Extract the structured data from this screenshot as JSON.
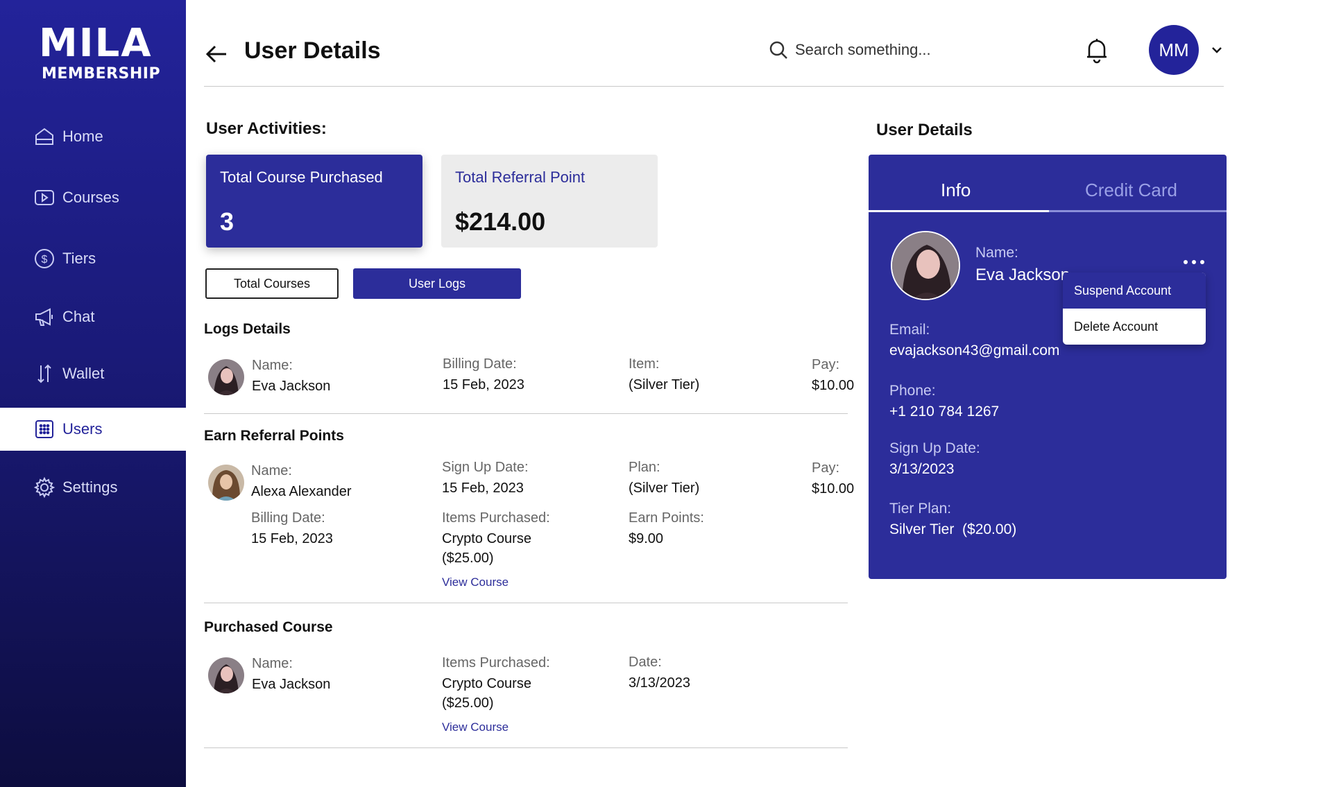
{
  "brand": {
    "logo_top": "MILA",
    "logo_bottom": "MEMBERSHIP"
  },
  "sidebar": {
    "items": [
      {
        "label": "Home",
        "icon": "home-icon"
      },
      {
        "label": "Courses",
        "icon": "play-icon"
      },
      {
        "label": "Tiers",
        "icon": "dollar-icon"
      },
      {
        "label": "Chat",
        "icon": "megaphone-icon"
      },
      {
        "label": "Wallet",
        "icon": "transfer-arrows-icon"
      },
      {
        "label": "Users",
        "icon": "users-grid-icon",
        "active": true
      },
      {
        "label": "Settings",
        "icon": "gear-icon"
      }
    ]
  },
  "header": {
    "title": "User Details",
    "search_placeholder": "Search something...",
    "avatar_initials": "MM"
  },
  "activities": {
    "heading": "User Activities:",
    "total_course_label": "Total Course Purchased",
    "total_course_value": "3",
    "referral_label": "Total Referral Point",
    "referral_value": "$214.00",
    "btn_total_courses": "Total Courses",
    "btn_user_logs": "User Logs"
  },
  "logs": {
    "heading": "Logs Details",
    "name_label": "Name:",
    "name_value": "Eva Jackson",
    "billing_label": "Billing Date:",
    "billing_value": "15 Feb, 2023",
    "item_label": "Item:",
    "item_value": "(Silver Tier)",
    "pay_label": "Pay:",
    "pay_value": "$10.00"
  },
  "referral": {
    "heading": "Earn Referral Points",
    "name_label": "Name:",
    "name_value": "Alexa Alexander",
    "signup_label": "Sign Up Date:",
    "signup_value": "15 Feb, 2023",
    "plan_label": "Plan:",
    "plan_value": "(Silver Tier)",
    "pay_label": "Pay:",
    "pay_value": "$10.00",
    "billing_label": "Billing Date:",
    "billing_value": "15 Feb, 2023",
    "items_label": "Items Purchased:",
    "items_value_1": "Crypto Course",
    "items_value_2": "($25.00)",
    "earn_label": "Earn Points:",
    "earn_value": "$9.00",
    "view_course": "View Course"
  },
  "purchased": {
    "heading": "Purchased Course",
    "name_label": "Name:",
    "name_value": "Eva Jackson",
    "items_label": "Items Purchased:",
    "items_value_1": "Crypto Course",
    "items_value_2": "($25.00)",
    "date_label": "Date:",
    "date_value": "3/13/2023",
    "view_course": "View Course"
  },
  "details_panel": {
    "heading": "User Details",
    "tab_info": "Info",
    "tab_credit": "Credit Card",
    "name_label": "Name:",
    "name_value": "Eva Jackson",
    "email_label": "Email:",
    "email_value": "evajackson43@gmail.com",
    "phone_label": "Phone:",
    "phone_value": "+1 210 784 1267",
    "signup_label": "Sign Up Date:",
    "signup_value": "3/13/2023",
    "tier_label": "Tier Plan:",
    "tier_value": "Silver Tier  ($20.00)",
    "menu_suspend": "Suspend Account",
    "menu_delete": "Delete Account"
  },
  "colors": {
    "primary": "#2c2d9a",
    "sidebar_top": "#23239a",
    "sidebar_bottom": "#0d0d3f"
  }
}
